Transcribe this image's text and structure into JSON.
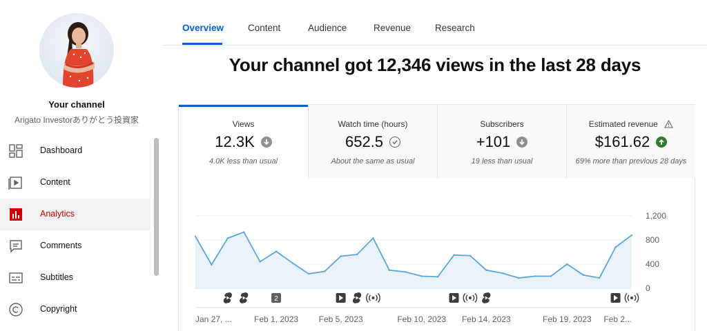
{
  "sidebar": {
    "channel_title": "Your channel",
    "channel_name": "Arigato Investorありがとう投資家",
    "items": [
      {
        "label": "Dashboard",
        "icon": "dashboard-icon"
      },
      {
        "label": "Content",
        "icon": "content-icon"
      },
      {
        "label": "Analytics",
        "icon": "analytics-icon",
        "active": true
      },
      {
        "label": "Comments",
        "icon": "comments-icon"
      },
      {
        "label": "Subtitles",
        "icon": "subtitles-icon"
      },
      {
        "label": "Copyright",
        "icon": "copyright-icon"
      }
    ]
  },
  "tabs": [
    "Overview",
    "Content",
    "Audience",
    "Revenue",
    "Research"
  ],
  "active_tab": "Overview",
  "headline": "Your channel got 12,346 views in the last 28 days",
  "metrics": [
    {
      "title": "Views",
      "value": "12.3K",
      "note": "4.0K less than usual",
      "trend": "down"
    },
    {
      "title": "Watch time (hours)",
      "value": "652.5",
      "note": "About the same as usual",
      "trend": "same"
    },
    {
      "title": "Subscribers",
      "value": "+101",
      "note": "19 less than usual",
      "trend": "down"
    },
    {
      "title": "Estimated revenue",
      "value": "$161.62",
      "note": "69% more than previous 28 days",
      "trend": "up",
      "warning": true
    }
  ],
  "colors": {
    "accent": "#065fd4",
    "active_nav": "#cc0000",
    "line": "#5aa5d6",
    "area": "#eaf2f9",
    "up": "#2e7d32",
    "neutral": "#909090"
  },
  "chart_data": {
    "type": "area",
    "ylim": [
      0,
      1200
    ],
    "yticks": [
      "1,200",
      "800",
      "400",
      "0"
    ],
    "ytick_values": [
      1200,
      800,
      400,
      0
    ],
    "x_labels": [
      "Jan 27, ...",
      "Feb 1, 2023",
      "Feb 5, 2023",
      "Feb 10, 2023",
      "Feb 14, 2023",
      "Feb 19, 2023",
      "Feb 2..."
    ],
    "x_label_index": [
      0,
      5,
      9,
      14,
      18,
      23,
      27
    ],
    "values": [
      860,
      390,
      830,
      930,
      440,
      610,
      420,
      240,
      280,
      530,
      560,
      830,
      300,
      270,
      200,
      190,
      550,
      540,
      300,
      250,
      170,
      200,
      200,
      400,
      220,
      170,
      680,
      880
    ],
    "markers": [
      {
        "index": 2,
        "type": "shorts"
      },
      {
        "index": 3,
        "type": "shorts"
      },
      {
        "index": 5,
        "type": "count",
        "label": "2"
      },
      {
        "index": 9,
        "type": "video"
      },
      {
        "index": 10,
        "type": "shorts"
      },
      {
        "index": 11,
        "type": "live"
      },
      {
        "index": 16,
        "type": "video"
      },
      {
        "index": 17,
        "type": "live"
      },
      {
        "index": 18,
        "type": "shorts"
      },
      {
        "index": 26,
        "type": "video"
      },
      {
        "index": 27,
        "type": "live"
      }
    ]
  }
}
